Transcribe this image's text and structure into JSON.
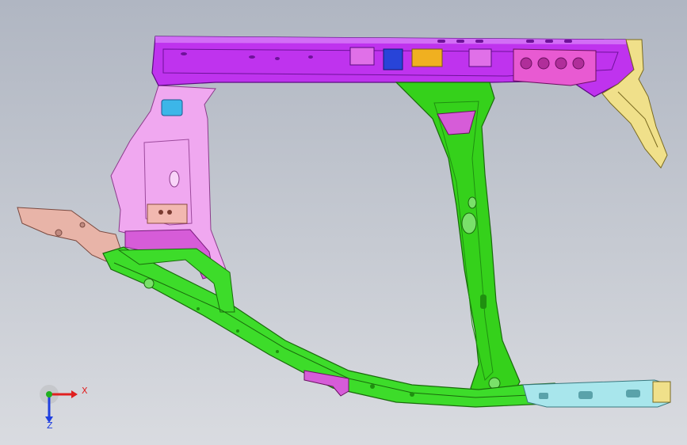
{
  "viewport": {
    "background_top": "#b0b6c2",
    "background_bottom": "#d9dbe0"
  },
  "parts": {
    "roof_rail": "#bf33ee",
    "roof_rail_dark": "#8e1bc0",
    "rear_pillar": "#f0a8f0",
    "inner_panel": "#d65cd8",
    "center_pillar": "#35d11b",
    "center_pillar_dark": "#1f8f10",
    "sill": "#3ddc2a",
    "rear_bracket": "#e8b4a8",
    "front_bracket": "#f0e08a",
    "front_sill": "#a8e6ec",
    "bracket_yellow": "#f0b020",
    "bracket_blue": "#2844d8"
  },
  "triad": {
    "x_label": "X",
    "z_label": "Z",
    "x_color": "#e02020",
    "y_color": "#20b020",
    "z_color": "#2040e0",
    "origin_icon": "coordinate-triad-icon"
  }
}
